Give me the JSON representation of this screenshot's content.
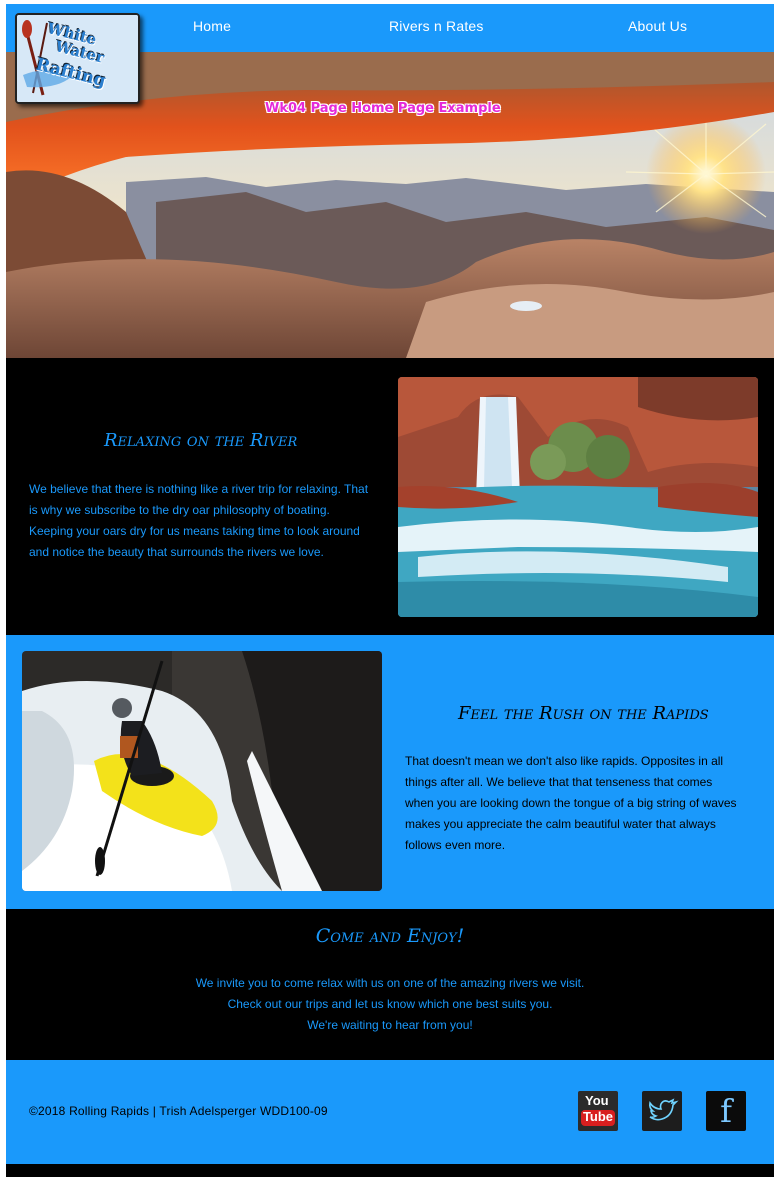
{
  "nav": {
    "items": [
      {
        "label": "Home"
      },
      {
        "label": "Rivers n Rates"
      },
      {
        "label": "About Us"
      }
    ],
    "logo": {
      "line1": "White",
      "line2": "Water",
      "line3": "Rafting"
    }
  },
  "hero": {
    "title": "Wk04 Page Home Page Example"
  },
  "section_relax": {
    "heading": "Relaxing on the River",
    "body": "We believe that there is nothing like a river trip for relaxing. That is why we subscribe to the dry oar philosophy of boating. Keeping your oars dry for us means taking time to look around and notice the beauty that surrounds the rivers we love."
  },
  "section_rush": {
    "heading": "Feel the Rush on the Rapids",
    "body": "That doesn't mean we don't also like rapids. Opposites in all things after all. We believe that that tenseness that comes when you are looking down the tongue of a big string of waves makes you appreciate the calm beautiful water that always follows even more."
  },
  "section_enjoy": {
    "heading": "Come and Enjoy!",
    "lines": [
      "We invite you to come relax with us on one of the amazing rivers we visit.",
      "Check out our trips and let us know which one best suits you.",
      "We're waiting to hear from you!"
    ]
  },
  "footer": {
    "copyright": "©2018 Rolling Rapids | Trish Adelsperger WDD100-09",
    "social": [
      {
        "name": "youtube-icon",
        "label_top": "You",
        "label_bottom": "Tube"
      },
      {
        "name": "twitter-icon"
      },
      {
        "name": "facebook-icon",
        "label": "f"
      }
    ]
  },
  "colors": {
    "nav_blue": "#1a99fb",
    "accent_text_blue": "#1a99fb",
    "hero_title_magenta": "#e52ad9"
  }
}
